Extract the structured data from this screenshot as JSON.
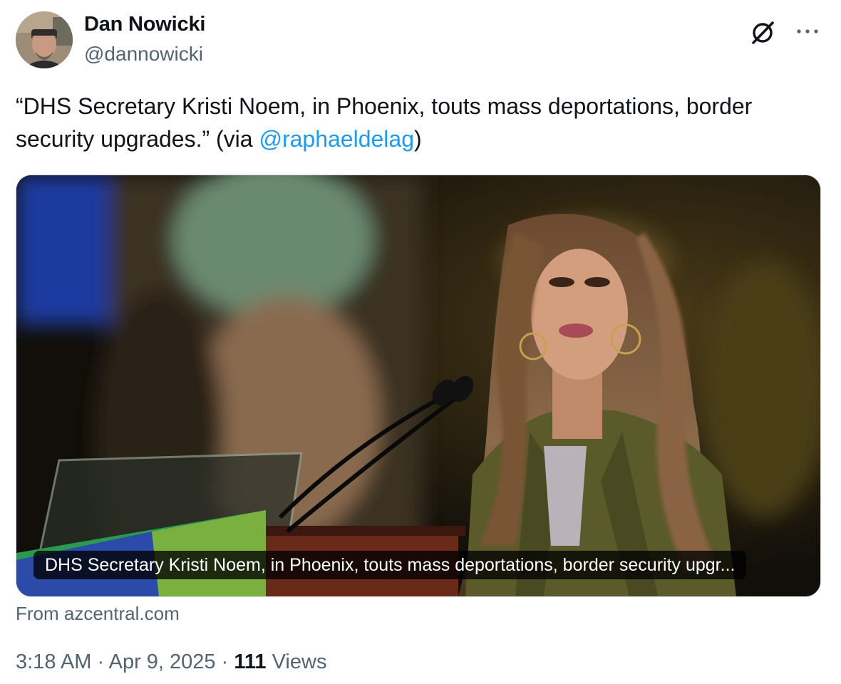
{
  "tweet": {
    "author": {
      "display_name": "Dan Nowicki",
      "handle": "@dannowicki"
    },
    "text_before_mention": "“DHS Secretary Kristi Noem, in Phoenix, touts mass deportations, border security upgrades.” (via ",
    "mention": "@raphaeldelag",
    "text_after_mention": ")",
    "media": {
      "caption": "DHS Secretary Kristi Noem, in Phoenix, touts mass deportations, border security upgr...",
      "source": "From azcentral.com"
    },
    "time": "3:18 AM",
    "separator": "·",
    "date": "Apr 9, 2025",
    "views_count": "111",
    "views_label": "Views"
  },
  "icons": {
    "grok": "grok-icon",
    "more": "more-icon"
  },
  "colors": {
    "text": "#0f1419",
    "secondary": "#536471",
    "link": "#1d9bf0",
    "border": "#cfd9de"
  }
}
